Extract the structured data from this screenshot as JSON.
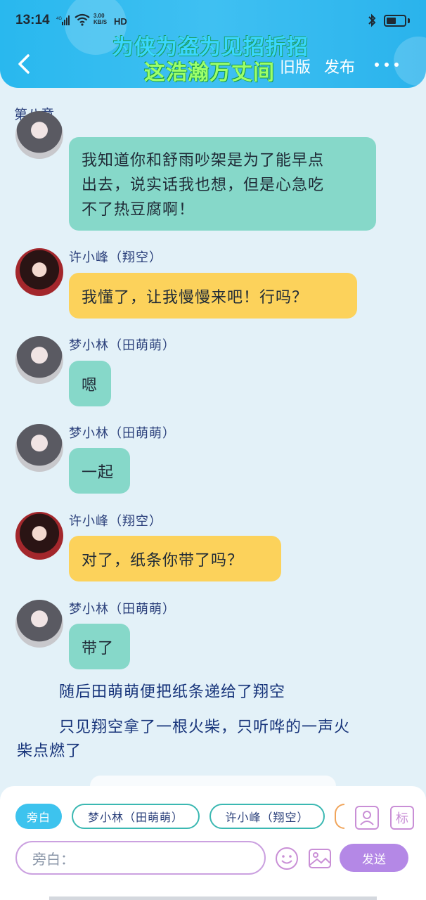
{
  "status_bar": {
    "time": "13:14",
    "network": "4G",
    "speed": "3.00",
    "speed_unit": "KB/S",
    "hd": "HD",
    "battery_level": 0.55
  },
  "header": {
    "title_line1": "为侠为盗为见招折招",
    "title_line2": "这浩瀚万丈间",
    "old_version": "旧版",
    "publish": "发布"
  },
  "chapter": "第八章",
  "messages": [
    {
      "text": "我知道你和舒雨吵架是为了能早点出去，说实话我也想，但是心急吃不了热豆腐啊！",
      "lines": [
        "我知道你和舒雨吵架是为了能早点",
        "出去，说实话我也想，但是心急吃",
        "不了热豆腐啊！"
      ]
    },
    {
      "speaker": "许小峰（翔空）",
      "text": "我懂了，让我慢慢来吧！行吗？"
    },
    {
      "speaker": "梦小林（田萌萌）",
      "text": "嗯"
    },
    {
      "speaker": "梦小林（田萌萌）",
      "text": "一起"
    },
    {
      "speaker": "许小峰（翔空）",
      "text": "对了，纸条你带了吗？"
    },
    {
      "speaker": "梦小林（田萌萌）",
      "text": "带了"
    }
  ],
  "narration": {
    "line1": "随后田萌萌便把纸条递给了翔空",
    "line2a": "只见翔空拿了一根火柴，只听哗的一声火",
    "line2b": "柴点燃了"
  },
  "composer": {
    "chip_narrator": "旁白",
    "chip_char1": "梦小林（田萌萌）",
    "chip_char2": "许小峰（翔空）",
    "mark_label": "标",
    "input_placeholder": "旁白：",
    "send_label": "发送"
  }
}
